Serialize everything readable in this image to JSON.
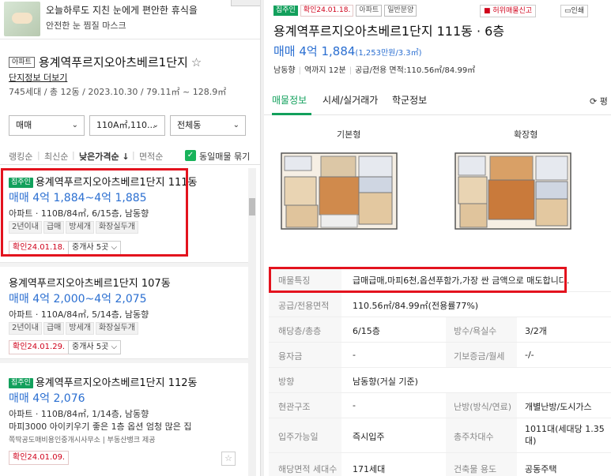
{
  "ad": {
    "line1": "오늘하루도 지친 눈에게 편안한 휴식을",
    "line2": "안전한 눈 찜질 마스크"
  },
  "complex": {
    "type_tag": "아파트",
    "name": "용계역푸르지오아츠베르1단지",
    "star": "☆",
    "info_link": "단지정보 더보기",
    "summary": "745세대 / 총 12동 / 2023.10.30 / 79.11㎡ ~ 128.9㎡"
  },
  "filters": {
    "deal": "매매",
    "area": "110A㎡,110...",
    "dong": "전체동"
  },
  "sort": {
    "items": [
      "랭킹순",
      "최신순",
      "낮은가격순 ↓",
      "면적순"
    ],
    "same_listing": "동일매물 묶기"
  },
  "listings": [
    {
      "badge": "집주인",
      "title": "용계역푸르지오아츠베르1단지 111동",
      "price": "매매 4억 1,884~4억 1,885",
      "spec": "아파트 · 110B/84㎡, 6/15층, 남동향",
      "tags": [
        "2년이내",
        "급매",
        "방세개",
        "화장실두개"
      ],
      "confirm": "확인24.01.18.",
      "agents": "중개사 5곳"
    },
    {
      "badge": "",
      "title": "용계역푸르지오아츠베르1단지 107동",
      "price": "매매 4억 2,000~4억 2,075",
      "spec": "아파트 · 110A/84㎡, 5/14층, 남동향",
      "tags": [
        "2년이내",
        "급매",
        "방세개",
        "화장실두개"
      ],
      "confirm": "확인24.01.29.",
      "agents": "중개사 5곳"
    },
    {
      "badge": "집주인",
      "title": "용계역푸르지오아츠베르1단지 112동",
      "price": "매매 4억 2,076",
      "spec": "아파트 · 110B/84㎡, 1/14층, 남동향",
      "desc": "마피3000 아이키우기 좋은 1층 옵션 엄청 많은 집",
      "source": "쪽딱공도매비용인중개시사무소 | 부동산뱅크 제공",
      "confirm": "확인24.01.09."
    }
  ],
  "detail": {
    "tags": [
      "집주인",
      "확인24.01.18.",
      "아파트",
      "일반분양"
    ],
    "report": "허위매물신고",
    "print": "인쇄",
    "title": "용계역푸르지오아츠베르1단지 111동 · 6층",
    "price": "매매 4억 1,884",
    "price_sub": "(1,253만원/3.3㎡)",
    "meta": [
      "남동향",
      "역까지 12분",
      "공급/전용 면적:110.56㎡/84.99㎡"
    ],
    "tabs": [
      "매물정보",
      "시세/실거래가",
      "학군정보"
    ],
    "refresh": "⟳ 평",
    "plan_basic": "기본형",
    "plan_ext": "확장형",
    "rows": [
      {
        "label": "매물특징",
        "value": "급매급매,마피6천,옵션푸함가,가장 싼 금액으로 매도합니다."
      },
      {
        "label": "공급/전용면적",
        "value": "110.56㎡/84.99㎡(전용률77%)"
      },
      {
        "label": "해당층/총층",
        "value": "6/15층",
        "label2": "방수/욕실수",
        "value2": "3/2개"
      },
      {
        "label": "융자금",
        "value": "-",
        "label2": "기보증금/월세",
        "value2": "-/-"
      },
      {
        "label": "방향",
        "value": "남동향(거실 기준)"
      },
      {
        "label": "현관구조",
        "value": "-",
        "label2": "난방(방식/연료)",
        "value2": "개별난방/도시가스"
      },
      {
        "label": "입주가능일",
        "value": "즉시입주",
        "label2": "총주차대수",
        "value2": "1011대(세대당 1.35대)"
      },
      {
        "label": "해당면적 세대수",
        "value": "171세대",
        "label2": "건축물 용도",
        "value2": "공동주택"
      }
    ]
  },
  "colors": {
    "accent_green": "#12a05c",
    "price_blue": "#2b6fd1",
    "highlight_red": "#e3131e"
  }
}
